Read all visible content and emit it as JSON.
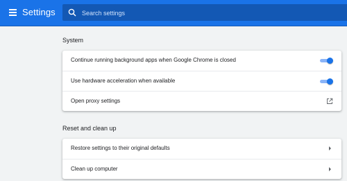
{
  "header": {
    "title": "Settings",
    "search_placeholder": "Search settings"
  },
  "sections": {
    "system": {
      "title": "System",
      "items": [
        {
          "label": "Continue running background apps when Google Chrome is closed",
          "control": "toggle",
          "state": "on"
        },
        {
          "label": "Use hardware acceleration when available",
          "control": "toggle",
          "state": "on"
        },
        {
          "label": "Open proxy settings",
          "control": "external-link-icon"
        }
      ]
    },
    "reset": {
      "title": "Reset and clean up",
      "items": [
        {
          "label": "Restore settings to their original defaults",
          "control": "arrow-right-icon"
        },
        {
          "label": "Clean up computer",
          "control": "arrow-right-icon"
        }
      ]
    }
  },
  "colors": {
    "accent": "#1a73e8",
    "background": "#f1f3f4",
    "toggle_track": "#8ab4f8"
  }
}
